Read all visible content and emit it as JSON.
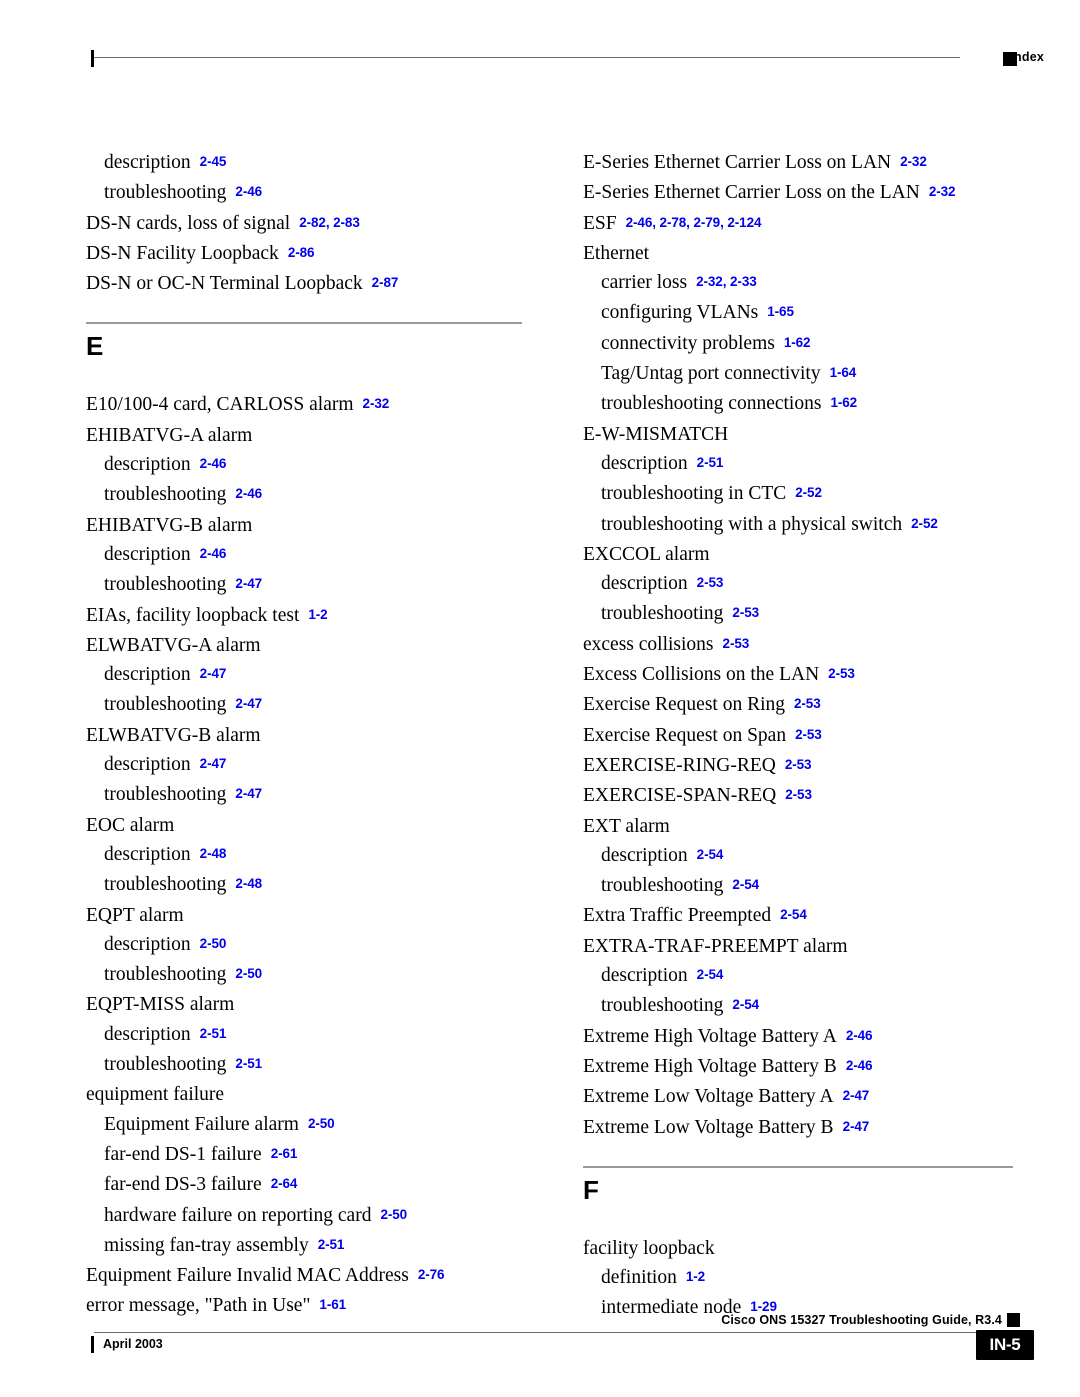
{
  "header": {
    "title": "Index"
  },
  "footer": {
    "guide": "Cisco ONS 15327 Troubleshooting Guide, R3.4",
    "date": "April 2003",
    "page_number": "IN-5"
  },
  "colors": {
    "page_link": "#0000EE",
    "rule": "#6D6D6D",
    "section_rule": "#9A9A9A",
    "text": "#000000"
  },
  "columns": {
    "left": [
      {
        "kind": "entry",
        "level": 2,
        "term": "description",
        "pages": "2-45"
      },
      {
        "kind": "entry",
        "level": 2,
        "term": "troubleshooting",
        "pages": "2-46"
      },
      {
        "kind": "entry",
        "level": 1,
        "term": "DS-N cards, loss of signal",
        "pages": "2-82, 2-83"
      },
      {
        "kind": "entry",
        "level": 1,
        "term": "DS-N Facility Loopback",
        "pages": "2-86"
      },
      {
        "kind": "entry",
        "level": 1,
        "term": "DS-N or OC-N Terminal Loopback",
        "pages": "2-87"
      },
      {
        "kind": "section",
        "letter": "E"
      },
      {
        "kind": "entry",
        "level": 1,
        "term": "E10/100-4 card, CARLOSS alarm",
        "pages": "2-32"
      },
      {
        "kind": "entry",
        "level": 1,
        "term": "EHIBATVG-A alarm",
        "pages": ""
      },
      {
        "kind": "entry",
        "level": 2,
        "term": "description",
        "pages": "2-46"
      },
      {
        "kind": "entry",
        "level": 2,
        "term": "troubleshooting",
        "pages": "2-46"
      },
      {
        "kind": "entry",
        "level": 1,
        "term": "EHIBATVG-B alarm",
        "pages": ""
      },
      {
        "kind": "entry",
        "level": 2,
        "term": "description",
        "pages": "2-46"
      },
      {
        "kind": "entry",
        "level": 2,
        "term": "troubleshooting",
        "pages": "2-47"
      },
      {
        "kind": "entry",
        "level": 1,
        "term": "EIAs, facility loopback test",
        "pages": "1-2"
      },
      {
        "kind": "entry",
        "level": 1,
        "term": "ELWBATVG-A alarm",
        "pages": ""
      },
      {
        "kind": "entry",
        "level": 2,
        "term": "description",
        "pages": "2-47"
      },
      {
        "kind": "entry",
        "level": 2,
        "term": "troubleshooting",
        "pages": "2-47"
      },
      {
        "kind": "entry",
        "level": 1,
        "term": "ELWBATVG-B alarm",
        "pages": ""
      },
      {
        "kind": "entry",
        "level": 2,
        "term": "description",
        "pages": "2-47"
      },
      {
        "kind": "entry",
        "level": 2,
        "term": "troubleshooting",
        "pages": "2-47"
      },
      {
        "kind": "entry",
        "level": 1,
        "term": "EOC alarm",
        "pages": ""
      },
      {
        "kind": "entry",
        "level": 2,
        "term": "description",
        "pages": "2-48"
      },
      {
        "kind": "entry",
        "level": 2,
        "term": "troubleshooting",
        "pages": "2-48"
      },
      {
        "kind": "entry",
        "level": 1,
        "term": "EQPT alarm",
        "pages": ""
      },
      {
        "kind": "entry",
        "level": 2,
        "term": "description",
        "pages": "2-50"
      },
      {
        "kind": "entry",
        "level": 2,
        "term": "troubleshooting",
        "pages": "2-50"
      },
      {
        "kind": "entry",
        "level": 1,
        "term": "EQPT-MISS alarm",
        "pages": ""
      },
      {
        "kind": "entry",
        "level": 2,
        "term": "description",
        "pages": "2-51"
      },
      {
        "kind": "entry",
        "level": 2,
        "term": "troubleshooting",
        "pages": "2-51"
      },
      {
        "kind": "entry",
        "level": 1,
        "term": "equipment failure",
        "pages": ""
      },
      {
        "kind": "entry",
        "level": 2,
        "term": "Equipment Failure alarm",
        "pages": "2-50"
      },
      {
        "kind": "entry",
        "level": 2,
        "term": "far-end DS-1 failure",
        "pages": "2-61"
      },
      {
        "kind": "entry",
        "level": 2,
        "term": "far-end DS-3 failure",
        "pages": "2-64"
      },
      {
        "kind": "entry",
        "level": 2,
        "term": "hardware failure on reporting card",
        "pages": "2-50"
      },
      {
        "kind": "entry",
        "level": 2,
        "term": "missing fan-tray assembly",
        "pages": "2-51"
      },
      {
        "kind": "entry",
        "level": 1,
        "term": "Equipment Failure Invalid MAC Address",
        "pages": "2-76"
      },
      {
        "kind": "entry",
        "level": 1,
        "term": "error message, \"Path in Use\"",
        "pages": "1-61"
      }
    ],
    "right": [
      {
        "kind": "entry",
        "level": 1,
        "term": "E-Series Ethernet Carrier Loss on LAN",
        "pages": "2-32"
      },
      {
        "kind": "entry",
        "level": 1,
        "term": "E-Series Ethernet Carrier Loss on the LAN",
        "pages": "2-32"
      },
      {
        "kind": "entry",
        "level": 1,
        "term": "ESF",
        "pages": "2-46, 2-78, 2-79, 2-124"
      },
      {
        "kind": "entry",
        "level": 1,
        "term": "Ethernet",
        "pages": ""
      },
      {
        "kind": "entry",
        "level": 2,
        "term": "carrier loss",
        "pages": "2-32, 2-33"
      },
      {
        "kind": "entry",
        "level": 2,
        "term": "configuring VLANs",
        "pages": "1-65"
      },
      {
        "kind": "entry",
        "level": 2,
        "term": "connectivity problems",
        "pages": "1-62"
      },
      {
        "kind": "entry",
        "level": 2,
        "term": "Tag/Untag port connectivity",
        "pages": "1-64"
      },
      {
        "kind": "entry",
        "level": 2,
        "term": "troubleshooting connections",
        "pages": "1-62"
      },
      {
        "kind": "entry",
        "level": 1,
        "term": "E-W-MISMATCH",
        "pages": ""
      },
      {
        "kind": "entry",
        "level": 2,
        "term": "description",
        "pages": "2-51"
      },
      {
        "kind": "entry",
        "level": 2,
        "term": "troubleshooting in CTC",
        "pages": "2-52"
      },
      {
        "kind": "entry",
        "level": 2,
        "term": "troubleshooting with a physical switch",
        "pages": "2-52"
      },
      {
        "kind": "entry",
        "level": 1,
        "term": "EXCCOL alarm",
        "pages": ""
      },
      {
        "kind": "entry",
        "level": 2,
        "term": "description",
        "pages": "2-53"
      },
      {
        "kind": "entry",
        "level": 2,
        "term": "troubleshooting",
        "pages": "2-53"
      },
      {
        "kind": "entry",
        "level": 1,
        "term": "excess collisions",
        "pages": "2-53"
      },
      {
        "kind": "entry",
        "level": 1,
        "term": "Excess Collisions on the LAN",
        "pages": "2-53"
      },
      {
        "kind": "entry",
        "level": 1,
        "term": "Exercise Request on Ring",
        "pages": "2-53"
      },
      {
        "kind": "entry",
        "level": 1,
        "term": "Exercise Request on Span",
        "pages": "2-53"
      },
      {
        "kind": "entry",
        "level": 1,
        "term": "EXERCISE-RING-REQ",
        "pages": "2-53"
      },
      {
        "kind": "entry",
        "level": 1,
        "term": "EXERCISE-SPAN-REQ",
        "pages": "2-53"
      },
      {
        "kind": "entry",
        "level": 1,
        "term": "EXT alarm",
        "pages": ""
      },
      {
        "kind": "entry",
        "level": 2,
        "term": "description",
        "pages": "2-54"
      },
      {
        "kind": "entry",
        "level": 2,
        "term": "troubleshooting",
        "pages": "2-54"
      },
      {
        "kind": "entry",
        "level": 1,
        "term": "Extra Traffic Preempted",
        "pages": "2-54"
      },
      {
        "kind": "entry",
        "level": 1,
        "term": "EXTRA-TRAF-PREEMPT alarm",
        "pages": ""
      },
      {
        "kind": "entry",
        "level": 2,
        "term": "description",
        "pages": "2-54"
      },
      {
        "kind": "entry",
        "level": 2,
        "term": "troubleshooting",
        "pages": "2-54"
      },
      {
        "kind": "entry",
        "level": 1,
        "term": "Extreme High Voltage Battery A",
        "pages": "2-46"
      },
      {
        "kind": "entry",
        "level": 1,
        "term": "Extreme High Voltage Battery B",
        "pages": "2-46"
      },
      {
        "kind": "entry",
        "level": 1,
        "term": "Extreme Low Voltage Battery A",
        "pages": "2-47"
      },
      {
        "kind": "entry",
        "level": 1,
        "term": "Extreme Low Voltage Battery B",
        "pages": "2-47"
      },
      {
        "kind": "section",
        "letter": "F"
      },
      {
        "kind": "entry",
        "level": 1,
        "term": "facility loopback",
        "pages": ""
      },
      {
        "kind": "entry",
        "level": 2,
        "term": "definition",
        "pages": "1-2"
      },
      {
        "kind": "entry",
        "level": 2,
        "term": "intermediate node",
        "pages": "1-29"
      }
    ]
  }
}
